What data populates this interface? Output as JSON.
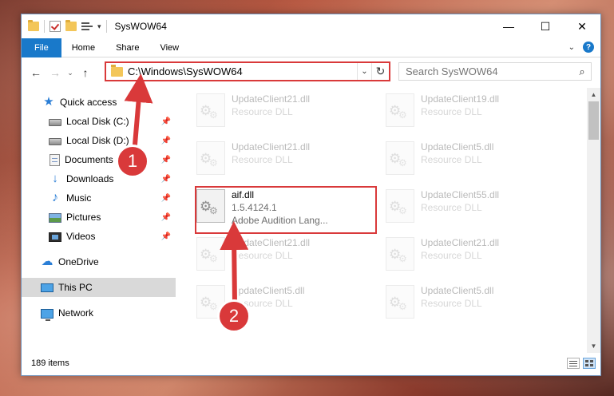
{
  "window": {
    "title": "SysWOW64",
    "controls": {
      "minimize": "—",
      "maximize": "☐",
      "close": "✕"
    }
  },
  "ribbon": {
    "tabs": [
      "File",
      "Home",
      "Share",
      "View"
    ]
  },
  "address": {
    "path": "C:\\Windows\\SysWOW64"
  },
  "search": {
    "placeholder": "Search SysWOW64"
  },
  "sidebar": {
    "items": [
      {
        "label": "Quick access",
        "icon": "star-icon"
      },
      {
        "label": "Local Disk (C:)",
        "icon": "disk-icon",
        "pinned": true
      },
      {
        "label": "Local Disk (D:)",
        "icon": "disk-icon",
        "pinned": true
      },
      {
        "label": "Documents",
        "icon": "documents-icon",
        "pinned": true
      },
      {
        "label": "Downloads",
        "icon": "download-icon",
        "pinned": true
      },
      {
        "label": "Music",
        "icon": "music-icon",
        "pinned": true
      },
      {
        "label": "Pictures",
        "icon": "pictures-icon",
        "pinned": true
      },
      {
        "label": "Videos",
        "icon": "videos-icon",
        "pinned": true
      },
      {
        "label": "OneDrive",
        "icon": "cloud-icon"
      },
      {
        "label": "This PC",
        "icon": "pc-icon",
        "selected": true
      },
      {
        "label": "Network",
        "icon": "network-icon"
      }
    ]
  },
  "files": [
    {
      "name": "UpdateClient21.dll",
      "desc": "Resource DLL"
    },
    {
      "name": "UpdateClient19.dll",
      "desc": "Resource DLL"
    },
    {
      "name": "UpdateClient21.dll",
      "desc": "Resource DLL"
    },
    {
      "name": "UpdateClient5.dll",
      "desc": "Resource DLL"
    },
    {
      "name": "aif.dll",
      "desc": "1.5.4124.1",
      "extra": "Adobe Audition Lang..."
    },
    {
      "name": "UpdateClient55.dll",
      "desc": "Resource DLL"
    },
    {
      "name": "UpdateClient21.dll",
      "desc": "Resource DLL"
    },
    {
      "name": "UpdateClient21.dll",
      "desc": "Resource DLL"
    },
    {
      "name": "UpdateClient5.dll",
      "desc": "Resource DLL"
    },
    {
      "name": "UpdateClient5.dll",
      "desc": "Resource DLL"
    }
  ],
  "status": {
    "count": "189 items"
  },
  "annotations": {
    "step1": "1",
    "step2": "2",
    "color": "#d9393a"
  }
}
